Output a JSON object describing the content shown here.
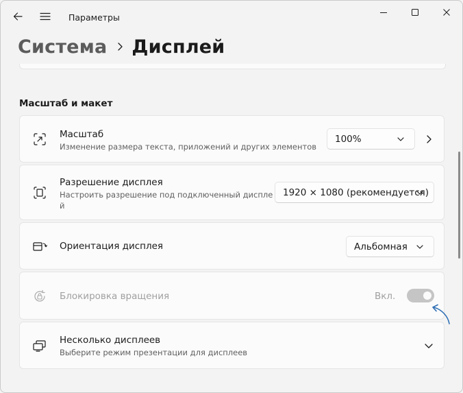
{
  "app": {
    "title": "Параметры"
  },
  "icons": {
    "back": "back-arrow-icon",
    "menu": "hamburger-menu-icon",
    "minimize": "minimize-icon",
    "maximize": "maximize-icon",
    "close": "close-icon"
  },
  "breadcrumb": {
    "parent": "Система",
    "current": "Дисплей"
  },
  "section": {
    "title": "Масштаб и макет"
  },
  "settings": {
    "scale": {
      "title": "Масштаб",
      "subtitle": "Изменение размера текста, приложений и других элементов",
      "value": "100%",
      "icon": "scale-icon"
    },
    "resolution": {
      "title": "Разрешение дисплея",
      "subtitle_line1": "Настроить разрешение под подключенный диспле",
      "subtitle_line2": "й",
      "value": "1920 × 1080 (рекомендуется)",
      "icon": "resolution-icon"
    },
    "orientation": {
      "title": "Ориентация дисплея",
      "value": "Альбомная",
      "icon": "orientation-icon"
    },
    "rotation_lock": {
      "title": "Блокировка вращения",
      "state_label": "Вкл.",
      "enabled": true,
      "disabled": true,
      "icon": "rotation-lock-icon"
    },
    "multiple_displays": {
      "title": "Несколько дисплеев",
      "subtitle": "Выберите режим презентации для дисплеев",
      "icon": "multiple-displays-icon"
    }
  },
  "colors": {
    "background": "#f3f3f3",
    "card": "#fbfbfb",
    "annotation_arrow": "#2f6fb5",
    "toggle_disabled": "#c5c5c5"
  }
}
